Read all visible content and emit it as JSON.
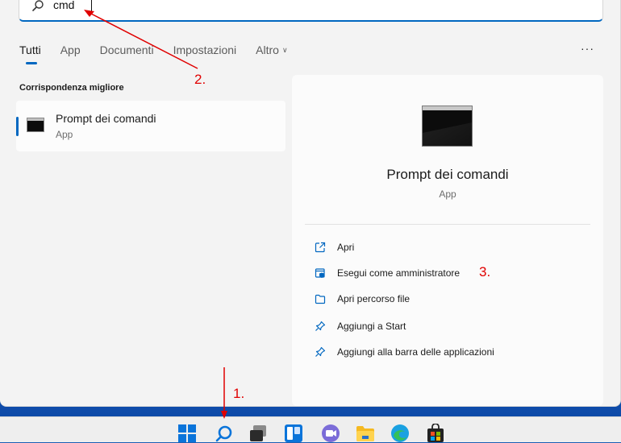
{
  "search": {
    "value": "cmd"
  },
  "tabs": [
    {
      "label": "Tutti"
    },
    {
      "label": "App"
    },
    {
      "label": "Documenti"
    },
    {
      "label": "Impostazioni"
    },
    {
      "label": "Altro"
    }
  ],
  "more_label": "···",
  "best_match": {
    "section_title": "Corrispondenza migliore",
    "title": "Prompt dei comandi",
    "subtitle": "App"
  },
  "detail": {
    "title": "Prompt dei comandi",
    "subtitle": "App",
    "actions": [
      {
        "label": "Apri",
        "icon": "open-icon"
      },
      {
        "label": "Esegui come amministratore",
        "icon": "shield-icon"
      },
      {
        "label": "Apri percorso file",
        "icon": "folder-icon"
      },
      {
        "label": "Aggiungi a Start",
        "icon": "pin-icon"
      },
      {
        "label": "Aggiungi alla barra delle applicazioni",
        "icon": "pin-icon"
      }
    ]
  },
  "annotations": {
    "step1": "1.",
    "step2": "2.",
    "step3": "3."
  },
  "taskbar": [
    "start-icon",
    "search-icon",
    "task-view-icon",
    "widgets-icon",
    "teams-chat-icon",
    "file-explorer-icon",
    "edge-icon",
    "store-icon"
  ],
  "colors": {
    "accent": "#0067c0",
    "annotation": "#e00000"
  }
}
